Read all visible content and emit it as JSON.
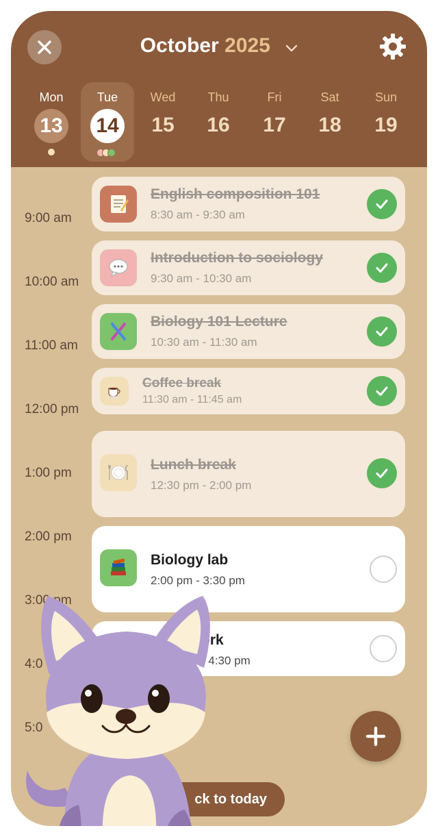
{
  "header": {
    "month": "October",
    "year": "2025",
    "close_icon": "close-icon",
    "settings_icon": "gear-icon"
  },
  "week": [
    {
      "name": "Mon",
      "num": "13",
      "state": "past"
    },
    {
      "name": "Tue",
      "num": "14",
      "state": "today"
    },
    {
      "name": "Wed",
      "num": "15",
      "state": "future"
    },
    {
      "name": "Thu",
      "num": "16",
      "state": "future"
    },
    {
      "name": "Fri",
      "num": "17",
      "state": "future"
    },
    {
      "name": "Sat",
      "num": "18",
      "state": "future"
    },
    {
      "name": "Sun",
      "num": "19",
      "state": "future"
    }
  ],
  "time_labels": [
    "9:00 am",
    "10:00 am",
    "11:00 am",
    "12:00 pm",
    "1:00 pm",
    "2:00 pm",
    "3:00 pm",
    "4:0",
    "5:0"
  ],
  "events": [
    {
      "title": "English composition 101",
      "time": "8:30 am - 9:30 am",
      "icon": "memo-icon",
      "done": true
    },
    {
      "title": "Introduction to sociology",
      "time": "9:30 am - 10:30 am",
      "icon": "speech-bubble-icon",
      "done": true
    },
    {
      "title": "Biology 101 Lecture",
      "time": "10:30 am - 11:30 am",
      "icon": "dna-icon",
      "done": true
    },
    {
      "title": "Coffee break",
      "time": "11:30 am - 11:45 am",
      "icon": "coffee-icon",
      "done": true
    },
    {
      "title": "Lunch break",
      "time": "12:30 pm - 2:00 pm",
      "icon": "plate-icon",
      "done": true
    },
    {
      "title": "Biology lab",
      "time": "2:00 pm - 3:30 pm",
      "icon": "books-icon",
      "done": false
    },
    {
      "title": "ork",
      "time": "- 4:30 pm",
      "icon": "",
      "done": false
    }
  ],
  "actions": {
    "add_icon": "plus-icon",
    "back_to_today": "ck to today"
  },
  "colors": {
    "header": "#8A5A3A",
    "background": "#D7BE96",
    "check": "#5BB55E",
    "mascot": "#B19CD0"
  }
}
